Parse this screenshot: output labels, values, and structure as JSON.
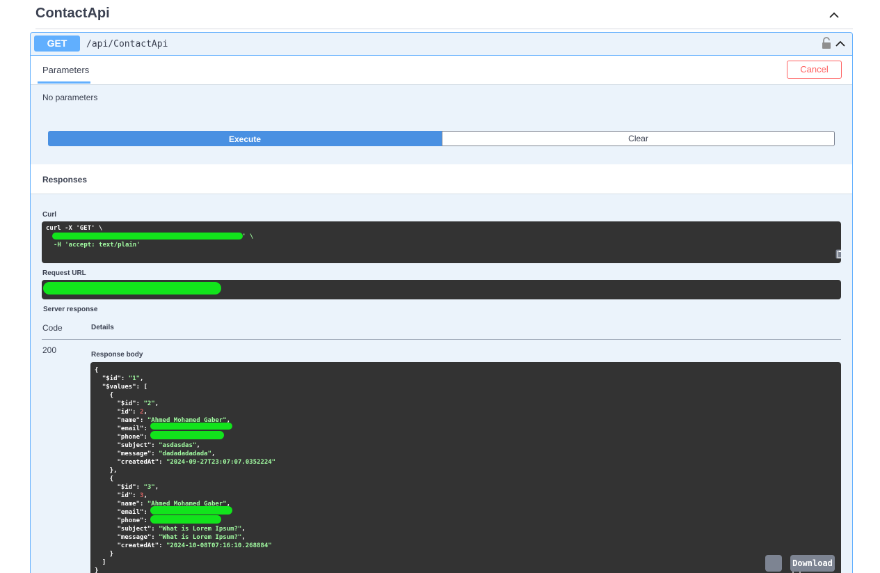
{
  "tag": {
    "title": "ContactApi"
  },
  "operation": {
    "method": "GET",
    "path": "/api/ContactApi"
  },
  "parameters": {
    "tab_label": "Parameters",
    "cancel_label": "Cancel",
    "empty_text": "No parameters"
  },
  "actions": {
    "execute_label": "Execute",
    "clear_label": "Clear"
  },
  "responses": {
    "title": "Responses",
    "curl_label": "Curl",
    "curl_line1": "curl -X 'GET' \\",
    "curl_line2_tail": "' \\",
    "curl_line3": "-H 'accept: text/plain'",
    "request_url_label": "Request URL",
    "server_response_label": "Server response",
    "code_header": "Code",
    "details_header": "Details",
    "status_code": "200",
    "body_label": "Response body",
    "download_label": "Download",
    "body_lines": [
      "{",
      "  \"$id\": \"1\",",
      "  \"$values\": [",
      "    {",
      "      \"$id\": \"2\",",
      "      \"id\": 2,",
      "      \"name\": \"Ahmed Mohamed Gaber\",",
      "      \"email\": ",
      "      \"phone\": ",
      "      \"subject\": \"asdasdas\",",
      "      \"message\": \"dadadadadada\",",
      "      \"createdAt\": \"2024-09-27T23:07:07.0352224\"",
      "    },",
      "    {",
      "      \"$id\": \"3\",",
      "      \"id\": 3,",
      "      \"name\": \"Ahmed Mohamed Gaber\",",
      "      \"email\": ",
      "      \"phone\": ",
      "      \"subject\": \"What is Lorem Ipsum?\",",
      "      \"message\": \"What is Lorem Ipsum?\",",
      "      \"createdAt\": \"2024-10-08T07:16:10.268884\"",
      "    }",
      "  ]",
      "}"
    ]
  },
  "colors": {
    "method_get": "#61affe",
    "execute": "#4990e2",
    "cancel": "#ff6060",
    "code_bg": "#333333",
    "string": "#a2fca2",
    "number": "#d36363",
    "redaction": "#12e41c"
  }
}
